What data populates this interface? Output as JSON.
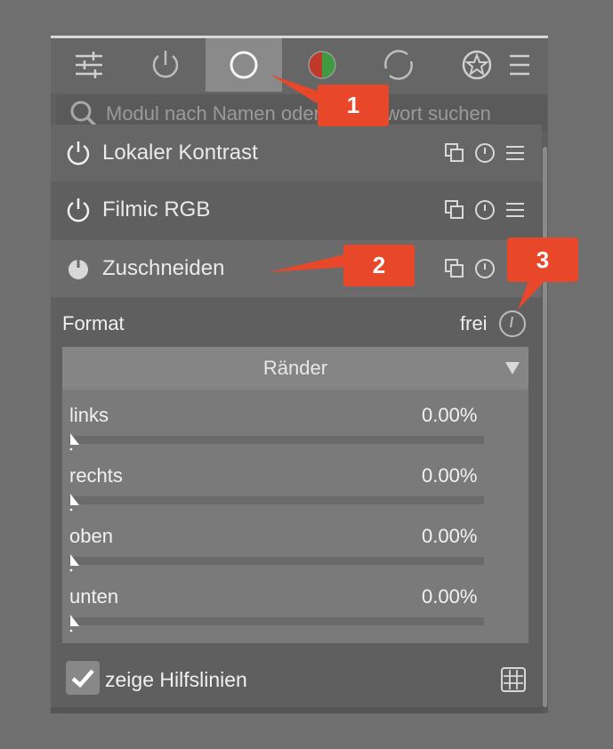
{
  "search": {
    "placeholder": "Modul nach Namen oder Schlagwort suchen"
  },
  "modules": [
    {
      "label": "Lokaler Kontrast"
    },
    {
      "label": "Filmic RGB"
    },
    {
      "label": "Zuschneiden"
    }
  ],
  "crop": {
    "format_label": "Format",
    "format_value": "frei",
    "borders_title": "Ränder",
    "sliders": [
      {
        "label": "links",
        "value": "0.00%"
      },
      {
        "label": "rechts",
        "value": "0.00%"
      },
      {
        "label": "oben",
        "value": "0.00%"
      },
      {
        "label": "unten",
        "value": "0.00%"
      }
    ],
    "guides_label": "zeige Hilfslinien",
    "guides_checked": true
  },
  "callouts": [
    {
      "label": "1"
    },
    {
      "label": "2"
    },
    {
      "label": "3"
    }
  ],
  "colors": {
    "accent": "#e8472a",
    "active_tab": "#8a8a8a"
  },
  "tabs": [
    {
      "icon": "sliders-icon"
    },
    {
      "icon": "power-icon"
    },
    {
      "icon": "circle-icon"
    },
    {
      "icon": "color-balance-icon"
    },
    {
      "icon": "refresh-circle-icon"
    },
    {
      "icon": "effects-icon"
    },
    {
      "icon": "menu-icon"
    }
  ]
}
